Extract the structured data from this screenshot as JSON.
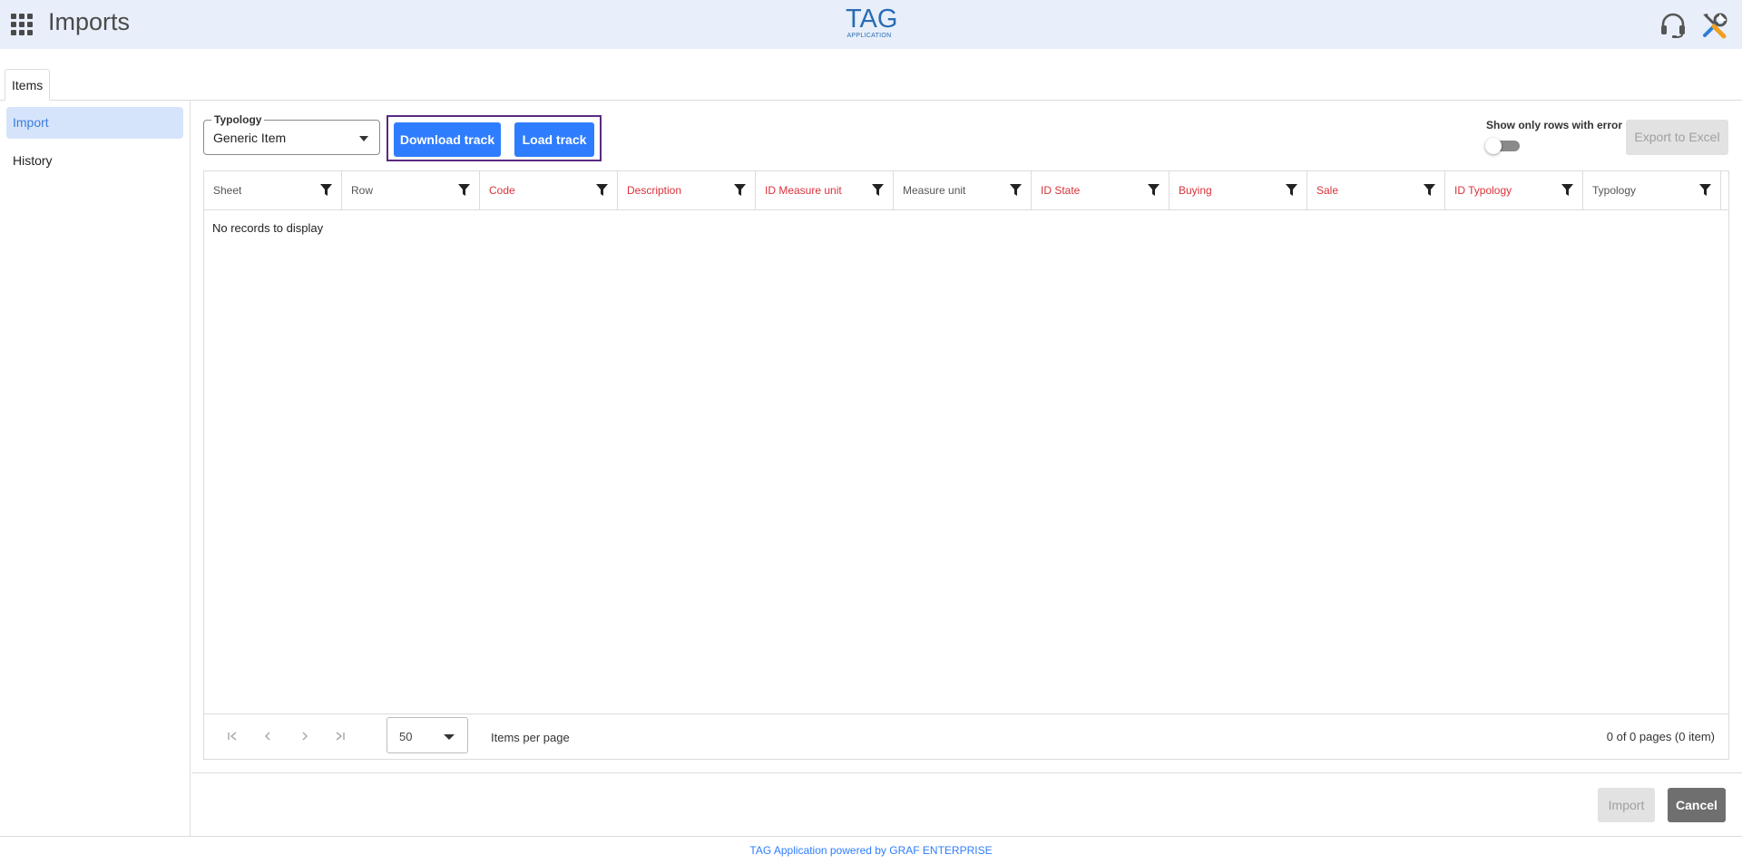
{
  "header": {
    "title": "Imports",
    "logo_main": "TAG",
    "logo_sub": "APPLICATION",
    "icons": [
      "apps-grid-icon",
      "headset-support-icon",
      "tools-icon"
    ]
  },
  "tabs": [
    {
      "label": "Items",
      "active": true
    }
  ],
  "sidebar": {
    "items": [
      {
        "label": "Import",
        "active": true
      },
      {
        "label": "History",
        "active": false
      }
    ]
  },
  "toolbar": {
    "typology_label": "Typology",
    "typology_value": "Generic Item",
    "download_label": "Download track",
    "load_label": "Load track",
    "toggle_label": "Show only rows with error",
    "toggle_on": false,
    "export_label": "Export to Excel"
  },
  "grid": {
    "columns": [
      {
        "title": "Sheet",
        "required": false
      },
      {
        "title": "Row",
        "required": false
      },
      {
        "title": "Code",
        "required": true
      },
      {
        "title": "Description",
        "required": true
      },
      {
        "title": "ID Measure unit",
        "required": true
      },
      {
        "title": "Measure unit",
        "required": false
      },
      {
        "title": "ID State",
        "required": true
      },
      {
        "title": "Buying",
        "required": true
      },
      {
        "title": "Sale",
        "required": true
      },
      {
        "title": "ID Typology",
        "required": true
      },
      {
        "title": "Typology",
        "required": false
      }
    ],
    "empty_text": "No records to display",
    "per_page_value": "50",
    "per_page_label": "Items per page",
    "page_info": "0 of 0 pages (0 item)"
  },
  "actions": {
    "import_label": "Import",
    "cancel_label": "Cancel"
  },
  "footer": {
    "text": "TAG Application powered by GRAF ENTERPRISE"
  },
  "colors": {
    "primary": "#2f7dff",
    "required_column": "#d9323a",
    "header_bg": "#e8effa",
    "highlight_border": "#5a2a82"
  }
}
